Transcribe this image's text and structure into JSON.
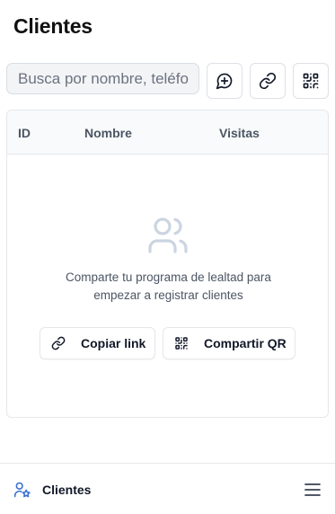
{
  "page": {
    "title": "Clientes"
  },
  "toolbar": {
    "search_placeholder": "Busca por nombre, teléfono",
    "icons": [
      "message-plus-icon",
      "link-icon",
      "qr-code-icon"
    ]
  },
  "table": {
    "columns": [
      "ID",
      "Nombre",
      "Visitas"
    ],
    "rows": []
  },
  "empty_state": {
    "icon": "users-icon",
    "message": "Comparte tu programa de lealtad para empezar a registrar clientes",
    "copy_link_label": "Copiar link",
    "share_qr_label": "Compartir QR"
  },
  "bottom_nav": {
    "active_label": "Clientes",
    "icons": [
      "user-star-icon",
      "menu-icon"
    ]
  },
  "colors": {
    "text": "#111827",
    "muted": "#4b5563",
    "border": "#e5e7eb",
    "header_bg": "#f9fafb",
    "empty_icon": "#cbd5e1",
    "nav_accent": "#3b6fd4"
  }
}
